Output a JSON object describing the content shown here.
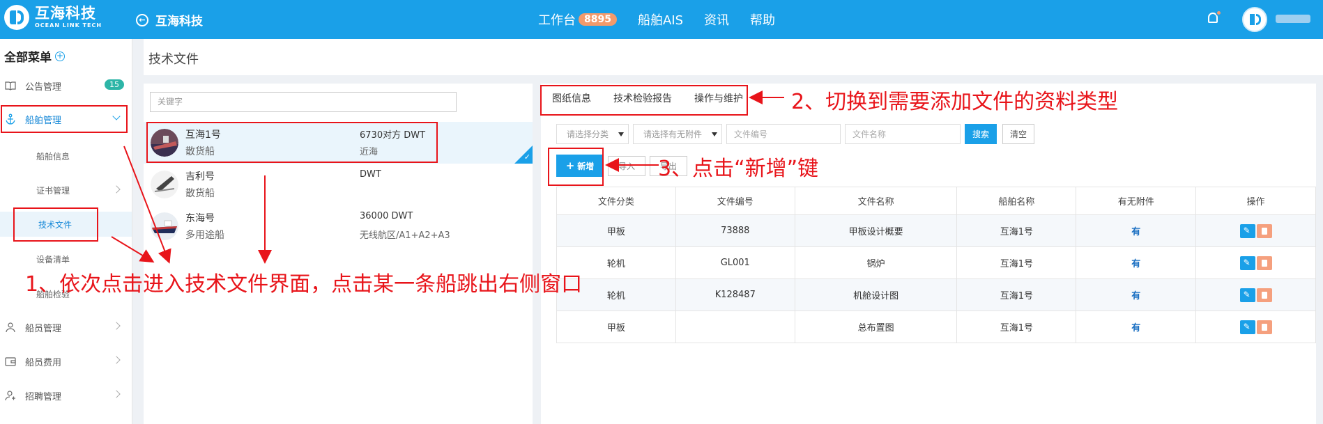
{
  "brand": {
    "name_cn": "互海科技",
    "name_en": "OCEAN LINK TECH"
  },
  "topbar": {
    "back_label": "互海科技",
    "nav": [
      {
        "label": "工作台",
        "badge": "8895"
      },
      {
        "label": "船舶AIS"
      },
      {
        "label": "资讯"
      },
      {
        "label": "帮助"
      }
    ]
  },
  "sidebar": {
    "title": "全部菜单",
    "items": [
      {
        "label": "公告管理",
        "badge": "15"
      },
      {
        "label": "船舶管理"
      },
      {
        "label": "船舶信息"
      },
      {
        "label": "证书管理"
      },
      {
        "label": "技术文件"
      },
      {
        "label": "设备清单"
      },
      {
        "label": "船舶检验"
      },
      {
        "label": "船员管理"
      },
      {
        "label": "船员费用"
      },
      {
        "label": "招聘管理"
      }
    ]
  },
  "page": {
    "title": "技术文件"
  },
  "ship_search": {
    "placeholder": "关键字"
  },
  "ships": [
    {
      "name": "互海1号",
      "type": "散货船",
      "dwt": "6730对方 DWT",
      "area": "近海"
    },
    {
      "name": "吉利号",
      "type": "散货船",
      "dwt": "DWT",
      "area": ""
    },
    {
      "name": "东海号",
      "type": "多用途船",
      "dwt": "36000 DWT",
      "area": "无线航区/A1+A2+A3"
    }
  ],
  "tabs": [
    "图纸信息",
    "技术检验报告",
    "操作与维护"
  ],
  "filters": {
    "category_placeholder": "请选择分类",
    "attachment_placeholder": "请选择有无附件",
    "file_no_placeholder": "文件编号",
    "file_name_placeholder": "文件名称",
    "search_label": "搜索",
    "clear_label": "清空"
  },
  "actions": {
    "add_label": "新增",
    "import_label": "导入",
    "export_label": "导出"
  },
  "table": {
    "headers": [
      "文件分类",
      "文件编号",
      "文件名称",
      "船舶名称",
      "有无附件",
      "操作"
    ],
    "rows": [
      [
        "甲板",
        "73888",
        "甲板设计概要",
        "互海1号",
        "有"
      ],
      [
        "轮机",
        "GL001",
        "锅炉",
        "互海1号",
        "有"
      ],
      [
        "轮机",
        "K128487",
        "机舱设计图",
        "互海1号",
        "有"
      ],
      [
        "甲板",
        "",
        "总布置图",
        "互海1号",
        "有"
      ]
    ]
  },
  "annotations": {
    "step1": "1、依次点击进入技术文件界面，点击某一条船跳出右侧窗口",
    "step2": "2、切换到需要添加文件的资料类型",
    "step3": "3、点击“新增”键"
  },
  "colors": {
    "primary": "#1aa0e8",
    "annotation": "#e8141a",
    "badge_orange": "#f39a6b",
    "badge_teal": "#2db5a7"
  }
}
